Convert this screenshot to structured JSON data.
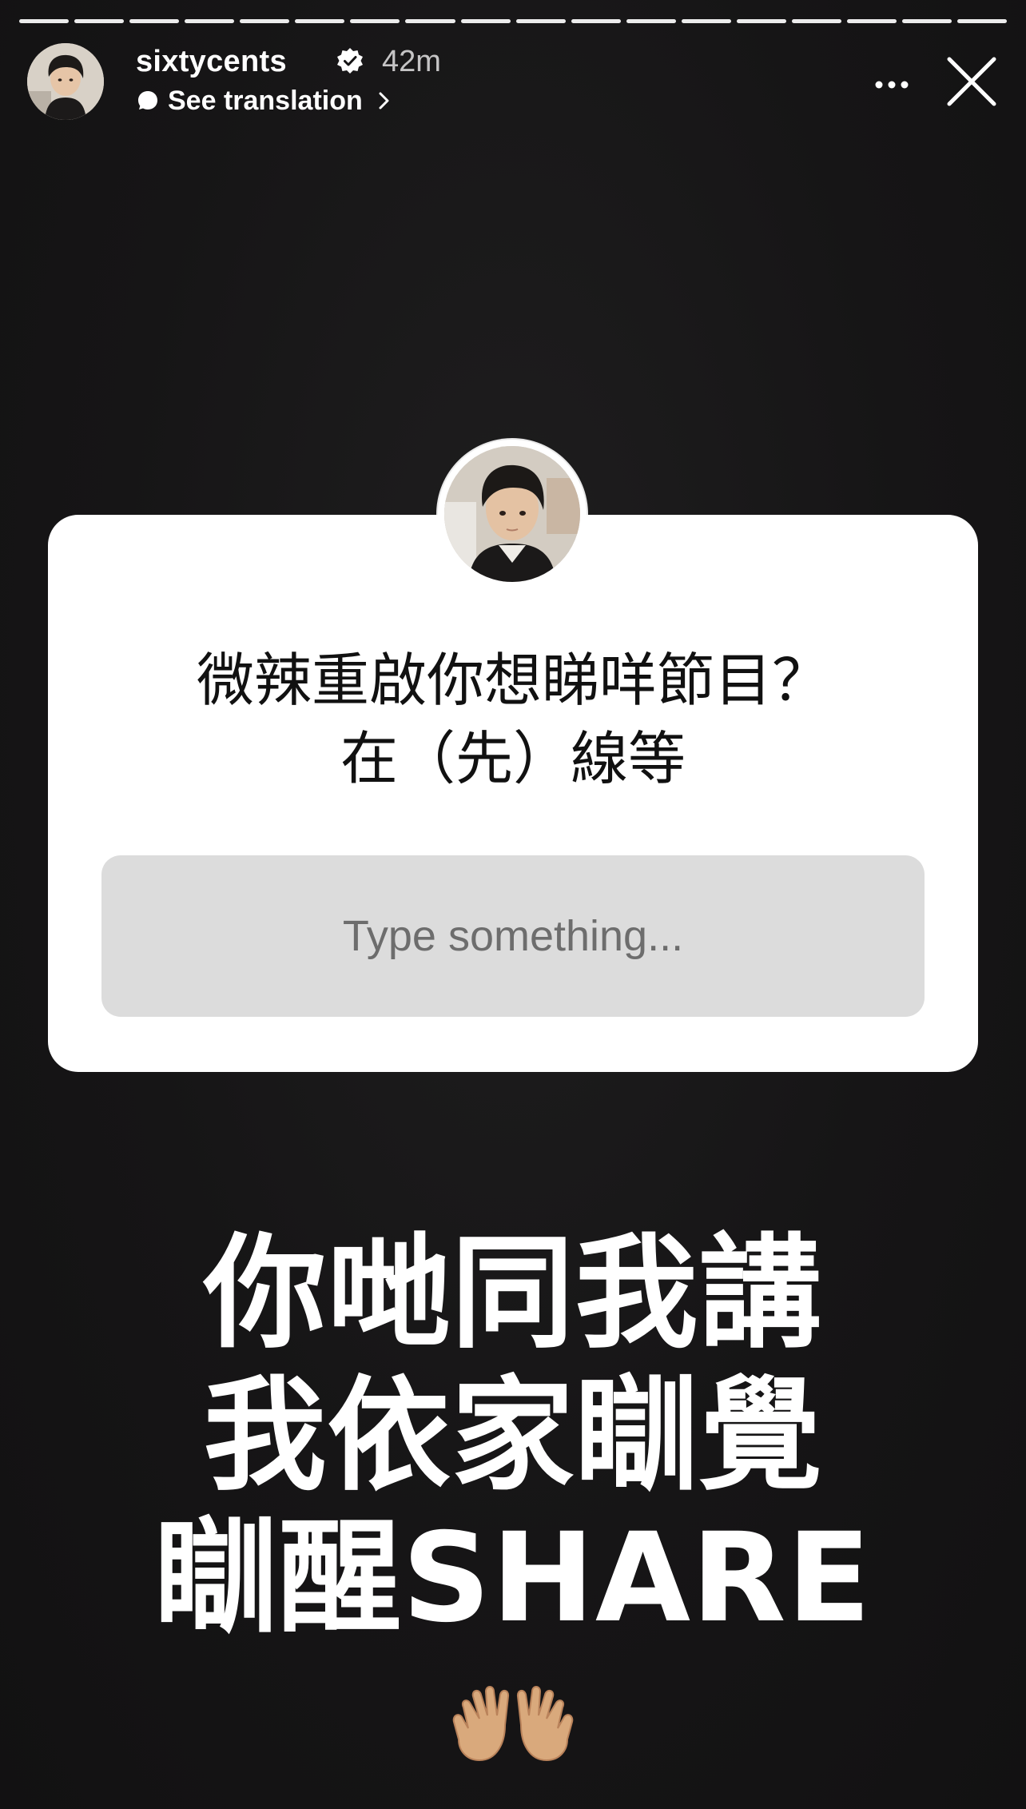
{
  "story": {
    "segment_count": 18,
    "segments_viewed": 18
  },
  "header": {
    "username": "sixtycents",
    "time_ago": "42m",
    "translation_label": "See translation",
    "more_icon": "more-horizontal-icon",
    "close_icon": "close-icon",
    "verified_icon": "verified-badge-icon"
  },
  "sticker": {
    "question_line1": "微辣重啟你想睇咩節目？",
    "question_line2": "在（先）線等",
    "answer_placeholder": "Type something..."
  },
  "caption": {
    "line1": "你哋同我講",
    "line2": "我依家瞓覺",
    "line3": "瞓醒SHARE",
    "emoji_icon": "open-hands-emoji-icon"
  },
  "colors": {
    "background": "#141314",
    "sticker_bg": "#ffffff",
    "answer_box_bg": "#dcdcdc"
  }
}
